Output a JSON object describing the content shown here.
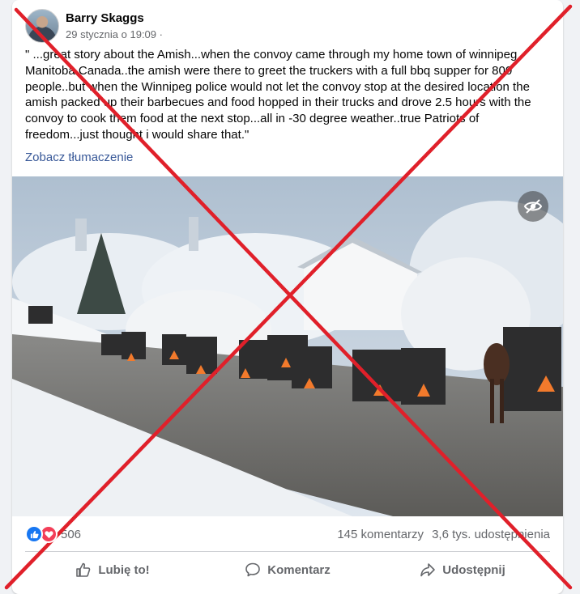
{
  "post": {
    "author": "Barry Skaggs",
    "timestamp": "29 stycznia o 19:09 ·",
    "text": "\" ...great story about the Amish...when the convoy came through my home town of winnipeg Manitoba Canada..the amish were there to greet the truckers with a full bbq supper for 800 people..but when the Winnipeg police would not let the convoy stop at the desired location the amish packed up their barbecues and food hopped in their trucks and drove 2.5 hours with the convoy to cook them food at the next stop...all in -30 degree weather..true Patriots of freedom...just thought i would share that.\"",
    "translate_link": "Zobacz tłumaczenie"
  },
  "stats": {
    "reaction_count": "506",
    "comments": "145 komentarzy",
    "shares": "3,6 tys. udostępnienia"
  },
  "actions": {
    "like": "Lubię to!",
    "comment": "Komentarz",
    "share": "Udostępnij"
  },
  "colors": {
    "cross": "#e0202a",
    "like": "#1877f2",
    "love": "#f33e58",
    "link": "#385898"
  }
}
